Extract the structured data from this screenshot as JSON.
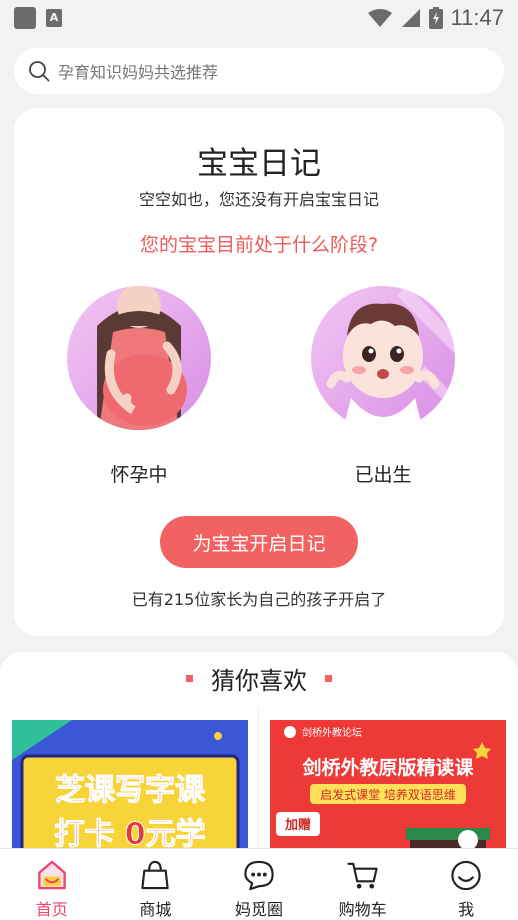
{
  "status_bar": {
    "time": "11:47"
  },
  "search": {
    "placeholder": "孕育知识妈妈共选推荐"
  },
  "diary": {
    "title": "宝宝日记",
    "subtitle": "空空如也，您还没有开启宝宝日记",
    "question": "您的宝宝目前处于什么阶段?",
    "stage_pregnant": "怀孕中",
    "stage_born": "已出生",
    "start_button": "为宝宝开启日记",
    "count_text": "已有215位家长为自己的孩子开启了"
  },
  "recommend": {
    "title": "猜你喜欢",
    "products": [
      {
        "line1": "芝课写字课",
        "line2": "打卡 0元学"
      },
      {
        "brand": "剑桥外教论坛",
        "headline": "剑桥外教原版精读课",
        "tagline": "启发式课堂 培养双语思维",
        "badge": "加赠"
      }
    ]
  },
  "nav": {
    "items": [
      {
        "label": "首页",
        "icon": "home-icon"
      },
      {
        "label": "商城",
        "icon": "bag-icon"
      },
      {
        "label": "妈觅圈",
        "icon": "chat-icon"
      },
      {
        "label": "购物车",
        "icon": "cart-icon"
      },
      {
        "label": "我",
        "icon": "smile-icon"
      }
    ],
    "active_color": "#f0446a"
  },
  "colors": {
    "accent": "#f26262",
    "question": "#ee5a5a"
  }
}
